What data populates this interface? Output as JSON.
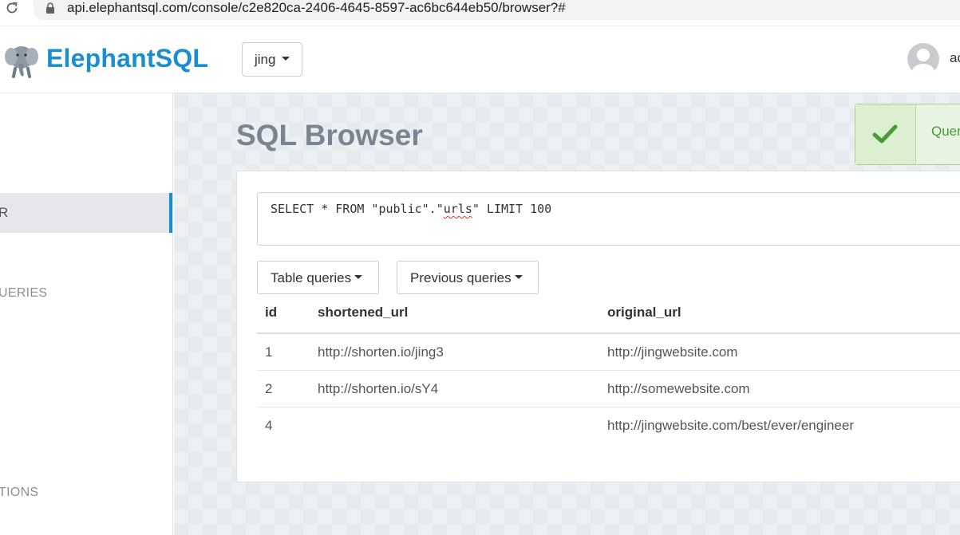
{
  "browser": {
    "url": "api.elephantsql.com/console/c2e820ca-2406-4645-8597-ac6bc644eb50/browser?#"
  },
  "header": {
    "brand": "ElephantSQL",
    "instance": "jing",
    "user": "ac"
  },
  "sidebar": {
    "active_item": "R",
    "section_1": "UERIES",
    "section_2": "TIONS"
  },
  "main": {
    "title": "SQL Browser",
    "toast": "Quer",
    "query": {
      "before": "SELECT * FROM \"public\".\"",
      "misspelled": "urls",
      "after": "\" LIMIT 100"
    },
    "buttons": {
      "table_queries": "Table queries",
      "previous_queries": "Previous queries"
    },
    "table": {
      "columns": [
        "id",
        "shortened_url",
        "original_url"
      ],
      "rows": [
        [
          "1",
          "http://shorten.io/jing3",
          "http://jingwebsite.com"
        ],
        [
          "2",
          "http://shorten.io/sY4",
          "http://somewebsite.com"
        ],
        [
          "4",
          "",
          "http://jingwebsite.com/best/ever/engineer"
        ]
      ]
    }
  },
  "colors": {
    "brand": "#1b8ed0",
    "success": "#4a9a36",
    "title": "#7b8591"
  },
  "icons": [
    "reload-icon",
    "lock-icon",
    "elephant-logo-icon",
    "chevron-down-icon",
    "user-avatar-icon",
    "check-icon"
  ]
}
